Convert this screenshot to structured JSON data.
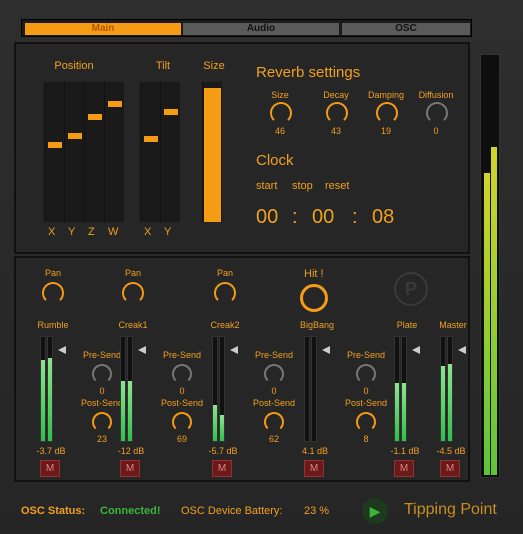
{
  "tabs": {
    "main": "Main",
    "audio": "Audio",
    "osc": "OSC"
  },
  "position": {
    "title": "Position",
    "axes": [
      "X",
      "Y",
      "Z",
      "W"
    ],
    "levels": [
      0.55,
      0.62,
      0.76,
      0.86
    ]
  },
  "tilt": {
    "title": "Tilt",
    "axes": [
      "X",
      "Y"
    ],
    "levels": [
      0.6,
      0.8
    ]
  },
  "size": {
    "title": "Size",
    "level": 0.97
  },
  "reverb": {
    "title": "Reverb settings",
    "knobs": [
      {
        "label": "Size",
        "value": "46"
      },
      {
        "label": "Decay",
        "value": "43"
      },
      {
        "label": "Damping",
        "value": "19"
      },
      {
        "label": "Diffusion",
        "value": "0"
      }
    ]
  },
  "clock": {
    "title": "Clock",
    "start": "start",
    "stop": "stop",
    "reset": "reset",
    "h": "00",
    "m": "00",
    "s": "08",
    "sep": ":"
  },
  "hit": {
    "label": "Hit !"
  },
  "pan_label": "Pan",
  "pre_send": "Pre-Send",
  "post_send": "Post-Send",
  "mute": "M",
  "channels": [
    {
      "name": "Rumble",
      "db": "-3.7 dB",
      "pre": "0",
      "post": "23",
      "levels": [
        0.78,
        0.8
      ]
    },
    {
      "name": "Creak1",
      "db": "-12 dB",
      "pre": "0",
      "post": "69",
      "levels": [
        0.58,
        0.58
      ]
    },
    {
      "name": "Creak2",
      "db": "-5.7 dB",
      "pre": "0",
      "post": "62",
      "levels": [
        0.35,
        0.25
      ]
    },
    {
      "name": "BigBang",
      "db": "4.1 dB",
      "pre": "0",
      "post": "8",
      "levels": [
        0,
        0
      ]
    },
    {
      "name": "Plate",
      "db": "-1.1 dB",
      "levels": [
        0.56,
        0.56
      ]
    },
    {
      "name": "Master",
      "db": "-4.5 dB",
      "levels": [
        0.72,
        0.74
      ]
    }
  ],
  "master_meter": {
    "levels": [
      0.72,
      0.78
    ]
  },
  "footer": {
    "osc_status_label": "OSC Status:",
    "osc_status_value": "Connected!",
    "battery_label": "OSC Device Battery:",
    "battery_value": "23 %",
    "brand": "Tipping Point"
  }
}
